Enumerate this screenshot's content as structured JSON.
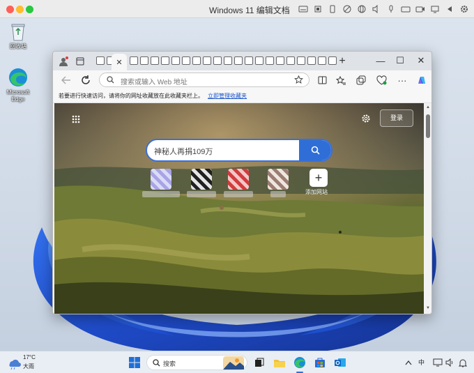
{
  "host": {
    "title": "Windows 11 编辑文档"
  },
  "desktop": {
    "icons": [
      {
        "label": "回收站",
        "icon": "recycle-bin-icon"
      },
      {
        "label": "Microsoft Edge",
        "icon": "edge-icon"
      }
    ]
  },
  "browser": {
    "address_placeholder": "搜索或输入 Web 地址",
    "favorites_hint": "若要进行快速访问，请将你的网址收藏放在此收藏夹栏上。",
    "favorites_link": "立即管理收藏夹",
    "ntp": {
      "search_text": "神秘人再捐109万",
      "login_label": "登录",
      "add_site_label": "添加网站"
    }
  },
  "taskbar": {
    "weather_temp": "17°C",
    "weather_desc": "大雨",
    "search_placeholder": "搜索",
    "ime_label": "中"
  },
  "colors": {
    "accent": "#2f6ed6",
    "mac_red": "#fe5f57",
    "mac_yellow": "#febc2e",
    "mac_green": "#28c840"
  }
}
